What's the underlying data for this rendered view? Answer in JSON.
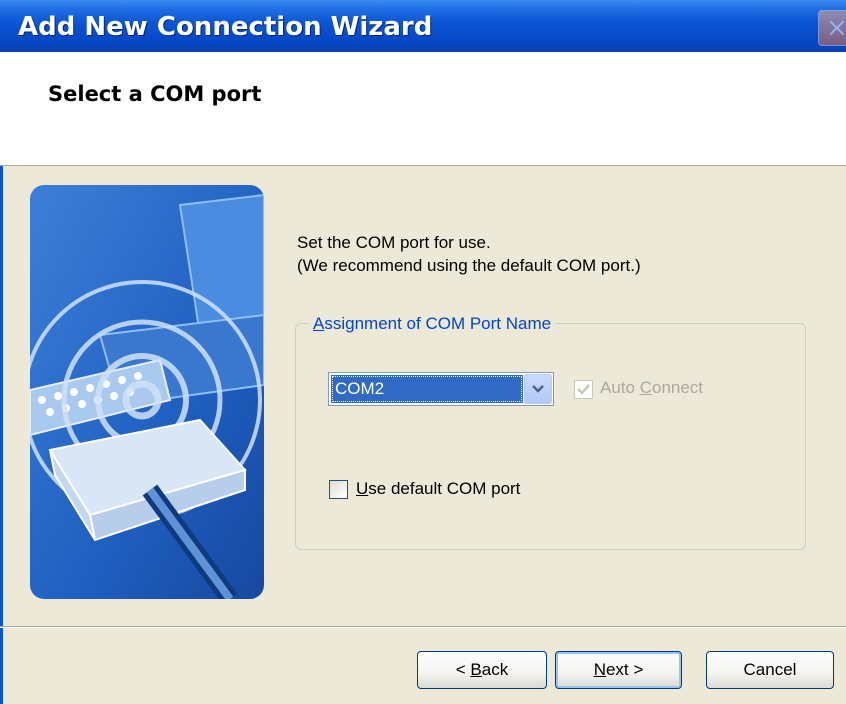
{
  "window": {
    "title": "Add New Connection Wizard",
    "close_glyph": "×"
  },
  "header": {
    "title": "Select a COM port"
  },
  "instructions": {
    "line1": "Set the COM port for use.",
    "line2": "(We recommend using the default COM port.)"
  },
  "group": {
    "legend_prefix": "",
    "legend_accel": "A",
    "legend_rest": "ssignment of COM Port Name"
  },
  "com_port": {
    "selected": "COM2"
  },
  "auto_connect": {
    "label_prefix": "Auto ",
    "label_accel": "C",
    "label_rest": "onnect",
    "checked": true,
    "enabled": false
  },
  "use_default": {
    "label_accel": "U",
    "label_rest": "se default COM port",
    "checked": false
  },
  "buttons": {
    "back_prefix": "< ",
    "back_accel": "B",
    "back_rest": "ack",
    "next_accel": "N",
    "next_rest": "ext >",
    "cancel": "Cancel"
  },
  "colors": {
    "titlebar": "#0a54d6",
    "dialog_bg": "#ece9d8",
    "selection": "#316ac5",
    "group_label": "#0046d5"
  },
  "icons": {
    "combo_arrow": "chevron-down-icon",
    "banner": "wireless-connection-illustration"
  }
}
